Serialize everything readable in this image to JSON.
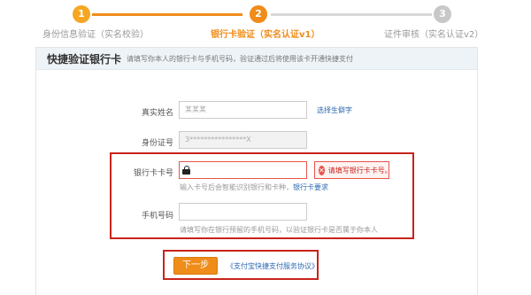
{
  "progress": {
    "steps": [
      {
        "num": "1",
        "label": "身份信息验证（实名校验）",
        "state": "done"
      },
      {
        "num": "2",
        "label": "银行卡验证（实名认证v1）",
        "state": "active"
      },
      {
        "num": "3",
        "label": "证件审核（实名认证v2）",
        "state": "pending"
      }
    ]
  },
  "panel": {
    "title": "快捷验证银行卡",
    "description": "请填写你本人的银行卡与手机号码，验证通过后将使用该卡开通快捷支付"
  },
  "form": {
    "name": {
      "label": "真实姓名",
      "value": "某某某",
      "link": "选择生僻字"
    },
    "id": {
      "label": "身份证号",
      "value": "3****************X"
    },
    "card": {
      "label": "银行卡卡号",
      "value": "",
      "error": "请填写银行卡卡号。",
      "hint": "输入卡号后会智能识别银行和卡种，",
      "hint_link": "银行卡要求"
    },
    "phone": {
      "label": "手机号码",
      "value": "",
      "hint": "请填写你在银行预留的手机号码，以验证银行卡是否属于你本人"
    },
    "next_label": "下一步",
    "agreement": "《支付宝快捷支付服务协议》"
  },
  "colors": {
    "accent": "#f08c1a",
    "error": "#c9231b",
    "link": "#2d6ab2"
  }
}
